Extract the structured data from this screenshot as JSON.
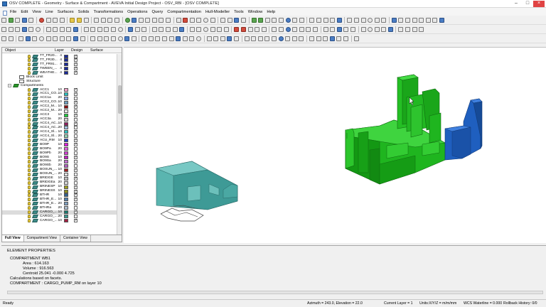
{
  "window": {
    "title": "OSV COMPLETE - Geometry - Surface & Compartment - AVEVA Initial Design Project - OSV_RBI - [OSV COMPLETE]"
  },
  "menu": [
    "File",
    "Edit",
    "View",
    "Line",
    "Surfaces",
    "Solids",
    "Transformations",
    "Operations",
    "Query",
    "Compartmentation",
    "Hull-Modeller",
    "Tools",
    "Window",
    "Help"
  ],
  "tree": {
    "columns": {
      "object": "Object",
      "layer": "Layer",
      "design": "Design",
      "surface": "Surface"
    },
    "rows": [
      {
        "indent": 1,
        "type": "lamp-ico",
        "label": "TT_FR20...",
        "layer": "4",
        "color": "#1a2a9a",
        "checked": true
      },
      {
        "indent": 1,
        "type": "lamp-ico",
        "label": "TT_FR30...",
        "layer": "4",
        "color": "#1a2a9a",
        "checked": true
      },
      {
        "indent": 1,
        "type": "lamp-ico",
        "label": "TT_FR91...",
        "layer": "4",
        "color": "#1a2a9a",
        "checked": true
      },
      {
        "indent": 1,
        "type": "lamp-ico",
        "label": "TWEEN_...",
        "layer": "4",
        "color": "#1a2a9a",
        "checked": true
      },
      {
        "indent": 1,
        "type": "lamp-ico",
        "label": "WEATHE...",
        "layer": "4",
        "color": "#1a2a9a",
        "checked": true
      },
      {
        "indent": 0,
        "type": "plain",
        "label": "Block Limit"
      },
      {
        "indent": 0,
        "type": "plain",
        "label": "Structure"
      },
      {
        "indent": -1,
        "type": "folder",
        "label": "Compartments"
      },
      {
        "indent": 1,
        "type": "lamp-ico",
        "label": "ACC1",
        "layer": "10",
        "color": "#f0a0c8",
        "checked": true
      },
      {
        "indent": 1,
        "type": "lamp-ico",
        "label": "ACC1_CO...",
        "layer": "10",
        "color": "#2ac0c0",
        "checked": true
      },
      {
        "indent": 1,
        "type": "lamp-ico",
        "label": "ACC1a",
        "layer": "20",
        "color": "#8aa8e8",
        "checked": false
      },
      {
        "indent": 1,
        "type": "lamp-ico",
        "label": "ACC2_CO...",
        "layer": "10",
        "color": "#70a0c0",
        "checked": true
      },
      {
        "indent": 1,
        "type": "lamp-ico",
        "label": "ACC2_M...",
        "layer": "10",
        "color": "#8a1010",
        "checked": true
      },
      {
        "indent": 1,
        "type": "lamp-ico",
        "label": "ACC2_M...",
        "layer": "20",
        "color": "#e8e8e8",
        "checked": false
      },
      {
        "indent": 1,
        "type": "lamp-ico",
        "label": "ACC3",
        "layer": "10",
        "color": "#20d040",
        "checked": true
      },
      {
        "indent": 1,
        "type": "lamp-ico",
        "label": "ACC3a",
        "layer": "20",
        "color": "#d0d0d0",
        "checked": false
      },
      {
        "indent": 1,
        "type": "lamp-ico",
        "label": "ACC4_AC...",
        "layer": "10",
        "color": "#902060",
        "checked": true
      },
      {
        "indent": 1,
        "type": "lamp-ico",
        "label": "ACC4_AC...",
        "layer": "20",
        "color": "#a0c0e0",
        "checked": false
      },
      {
        "indent": 1,
        "type": "lamp-ico",
        "label": "ACC4_Sl...",
        "layer": "10",
        "color": "#30c0c0",
        "checked": true
      },
      {
        "indent": 1,
        "type": "lamp-ico",
        "label": "ACC4_Sl...",
        "layer": "20",
        "color": "#90d0b0",
        "checked": false
      },
      {
        "indent": 1,
        "type": "lamp-ico",
        "label": "ACU_RM",
        "layer": "10",
        "color": "#2040c0",
        "checked": true
      },
      {
        "indent": 1,
        "type": "lamp-ico",
        "label": "BO9P",
        "layer": "10",
        "color": "#e020e0",
        "checked": true
      },
      {
        "indent": 1,
        "type": "lamp-ico",
        "label": "BO9Pa",
        "layer": "20",
        "color": "#e060e0",
        "checked": false
      },
      {
        "indent": 1,
        "type": "lamp-ico",
        "label": "BO9Pb",
        "layer": "20",
        "color": "#d040d0",
        "checked": false
      },
      {
        "indent": 1,
        "type": "lamp-ico",
        "label": "BO9S",
        "layer": "10",
        "color": "#c020c0",
        "checked": true
      },
      {
        "indent": 1,
        "type": "lamp-ico",
        "label": "BO9Sa",
        "layer": "20",
        "color": "#c070d0",
        "checked": false
      },
      {
        "indent": 1,
        "type": "lamp-ico",
        "label": "BO9Sb",
        "layer": "20",
        "color": "#b060c0",
        "checked": false
      },
      {
        "indent": 1,
        "type": "lamp-ico",
        "label": "BOSUN_...",
        "layer": "10",
        "color": "#a02020",
        "checked": true
      },
      {
        "indent": 1,
        "type": "lamp-ico",
        "label": "BOSUN_...",
        "layer": "20",
        "color": "#e0e0e0",
        "checked": false
      },
      {
        "indent": 1,
        "type": "lamp-ico",
        "label": "BRIDGE",
        "layer": "10",
        "color": "#c0c0c0",
        "checked": true
      },
      {
        "indent": 1,
        "type": "lamp-ico",
        "label": "BRIDGEa",
        "layer": "20",
        "color": "#d8d8d8",
        "checked": false
      },
      {
        "indent": 1,
        "type": "lamp-ico",
        "label": "BRINESP",
        "layer": "10",
        "color": "#a0a020",
        "checked": true
      },
      {
        "indent": 1,
        "type": "lamp-ico",
        "label": "BRINESS",
        "layer": "10",
        "color": "#909020",
        "checked": true
      },
      {
        "indent": 1,
        "type": "lamp-ico",
        "label": "BTHR",
        "layer": "10",
        "color": "#306090",
        "checked": true
      },
      {
        "indent": 1,
        "type": "lamp-ico",
        "label": "BTHR_E...",
        "layer": "10",
        "color": "#5080b0",
        "checked": true
      },
      {
        "indent": 1,
        "type": "lamp-ico",
        "label": "BTHR_E...",
        "layer": "20",
        "color": "#80a0c0",
        "checked": false
      },
      {
        "indent": 1,
        "type": "lamp-ico",
        "label": "BTHRa",
        "layer": "20",
        "color": "#b0c0d0",
        "checked": false
      },
      {
        "indent": 1,
        "type": "lamp-ico",
        "label": "CARGO_...",
        "layer": "10",
        "color": "#1a7a70",
        "checked": true,
        "selected": true
      },
      {
        "indent": 1,
        "type": "lamp-ico",
        "label": "CARGO_...",
        "layer": "20",
        "color": "#3a9a90",
        "checked": false
      },
      {
        "indent": 1,
        "type": "lamp-ico",
        "label": "CARGO_...",
        "layer": "10",
        "color": "#a02040",
        "checked": true
      }
    ]
  },
  "tabs": [
    "Full View",
    "Compartment View",
    "Container View"
  ],
  "properties": {
    "title": "ELEMENT PROPERTIES",
    "lines": [
      "COMPARTMENT WB1",
      "Area    :  614.163",
      "Volume  :  916.563",
      "Centroid 25.041 -0.000 4.725",
      "Calculations based on facets.",
      "COMPARTMENT : CARGO_PUMP_RM on layer 10"
    ]
  },
  "status": {
    "ready": "Ready",
    "azimuth": "Azimuth = 243.0, Elevation = 22.0",
    "layer": "Current Layer = 1",
    "units": "Units:X/Y/Z = m/m/mm",
    "waterline": "WCS Waterline = 0.000",
    "rollback": "Rollback History: 0/0"
  },
  "colors": {
    "green_compartment": "#1fb51f",
    "blue_compartment": "#1f5fbf",
    "teal_compartment": "#4aa5a5"
  }
}
